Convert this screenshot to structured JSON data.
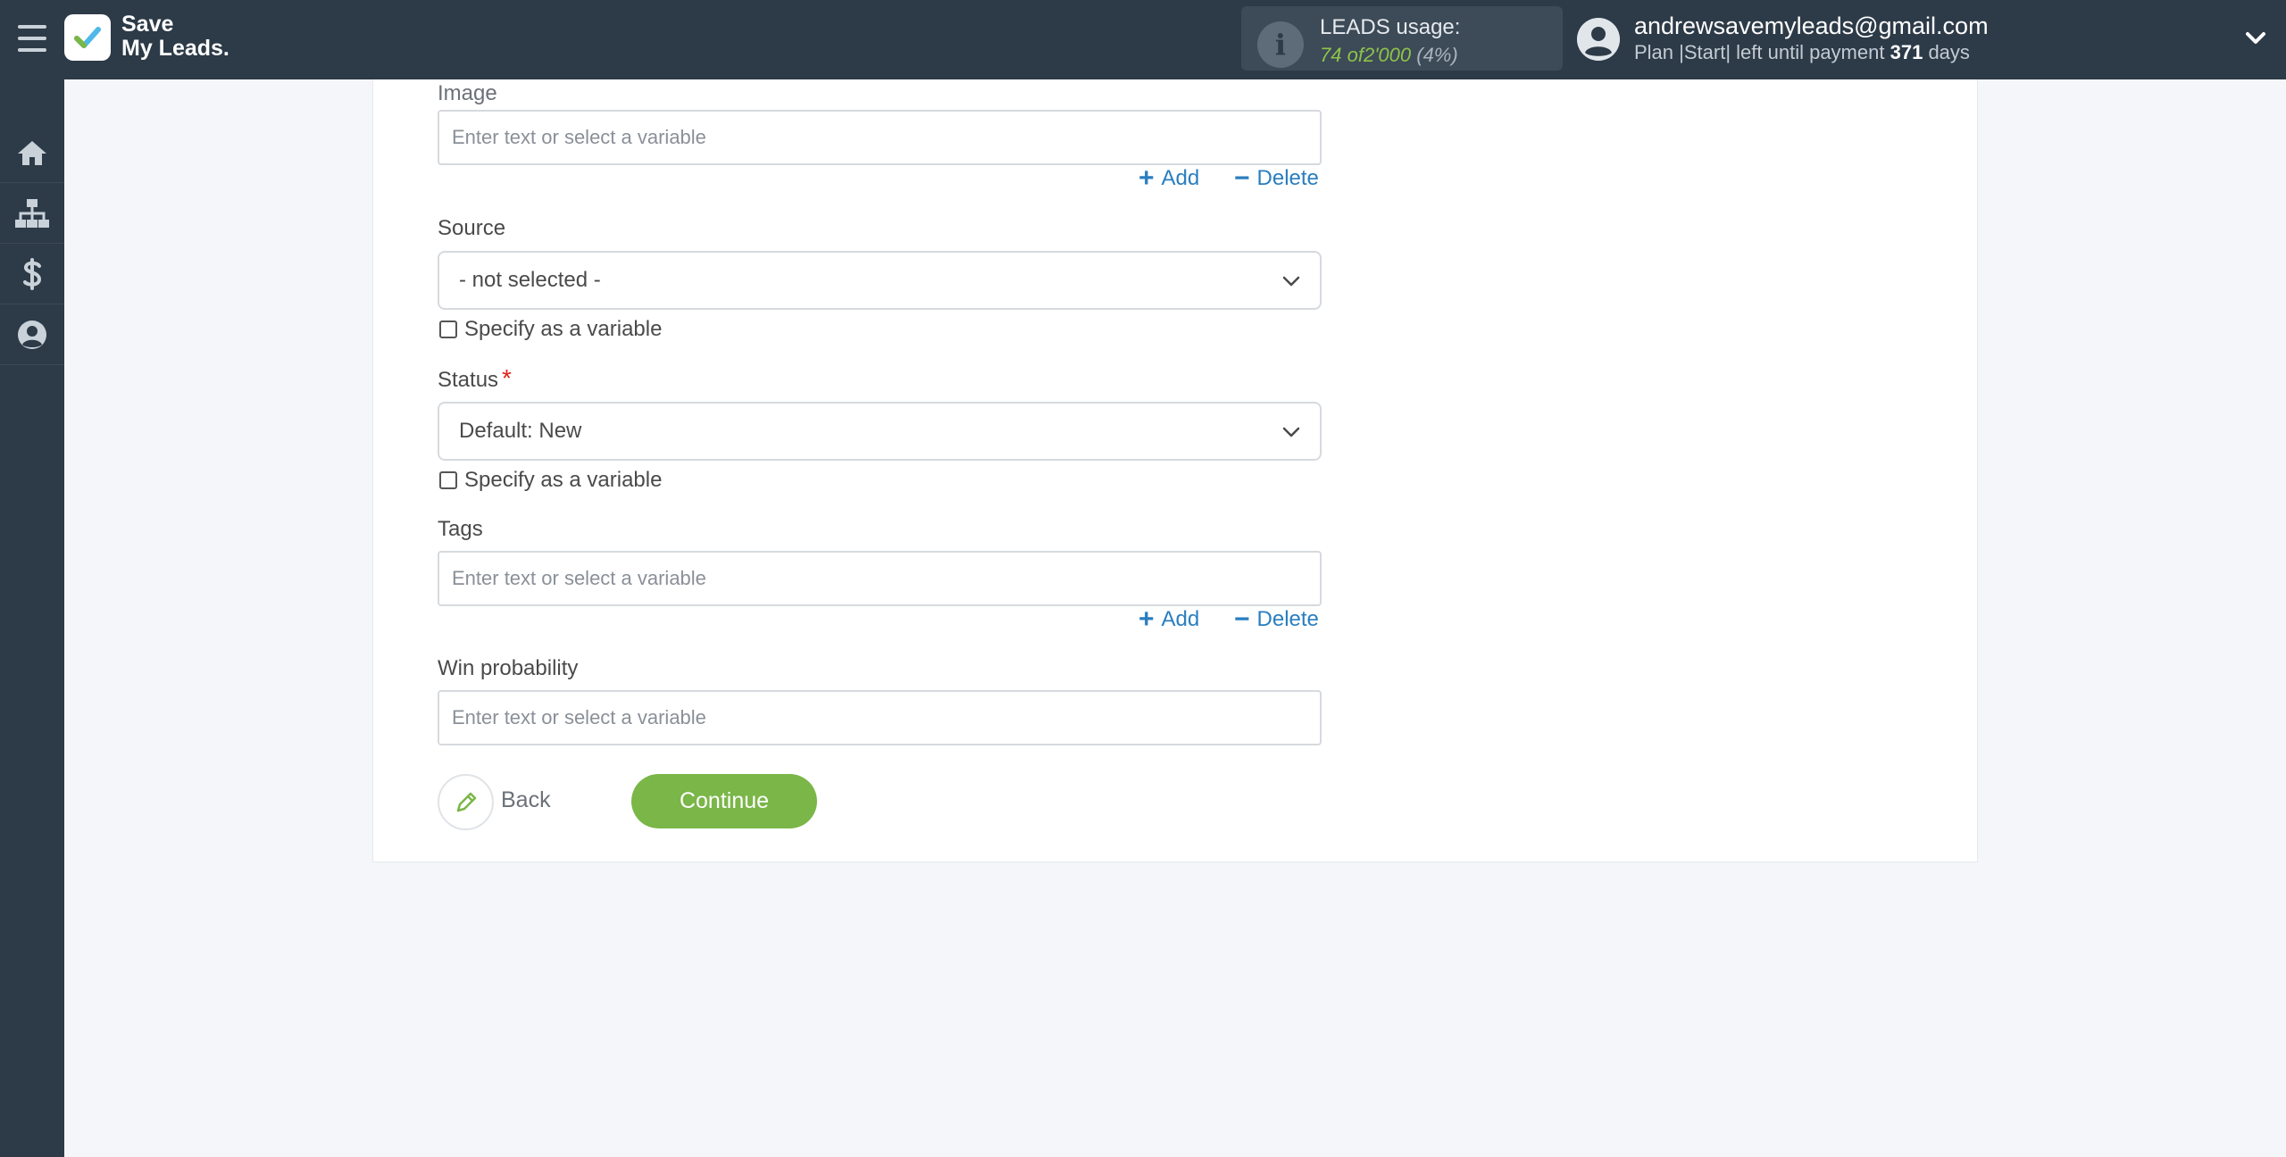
{
  "brand": {
    "line1": "Save",
    "line2": "My Leads."
  },
  "usage": {
    "title": "LEADS usage:",
    "used": "74",
    "of_word": "of",
    "limit": "2'000",
    "percent": "(4%)"
  },
  "user": {
    "email": "andrewsavemyleads@gmail.com",
    "plan_prefix": "Plan |Start| left until payment",
    "days_left": "371",
    "days_suffix": "days"
  },
  "sidebar": {
    "items": [
      {
        "icon": "home-icon"
      },
      {
        "icon": "sitemap-icon"
      },
      {
        "icon": "dollar-icon"
      },
      {
        "icon": "user-circle-icon"
      }
    ]
  },
  "form": {
    "image": {
      "label": "Image",
      "placeholder": "Enter text or select a variable",
      "value": ""
    },
    "add_label": "Add",
    "delete_label": "Delete",
    "source": {
      "label": "Source",
      "selected": "- not selected -"
    },
    "specify_variable": "Specify as a variable",
    "status": {
      "label": "Status",
      "required": "*",
      "selected": "Default: New"
    },
    "tags": {
      "label": "Tags",
      "placeholder": "Enter text or select a variable",
      "value": ""
    },
    "win_probability": {
      "label": "Win probability",
      "placeholder": "Enter text or select a variable",
      "value": ""
    }
  },
  "actions": {
    "back": "Back",
    "continue": "Continue"
  },
  "colors": {
    "topbar": "#2d3a47",
    "accent_green": "#7ab648",
    "link_blue": "#2a7ebf",
    "required_red": "#e2231a"
  }
}
